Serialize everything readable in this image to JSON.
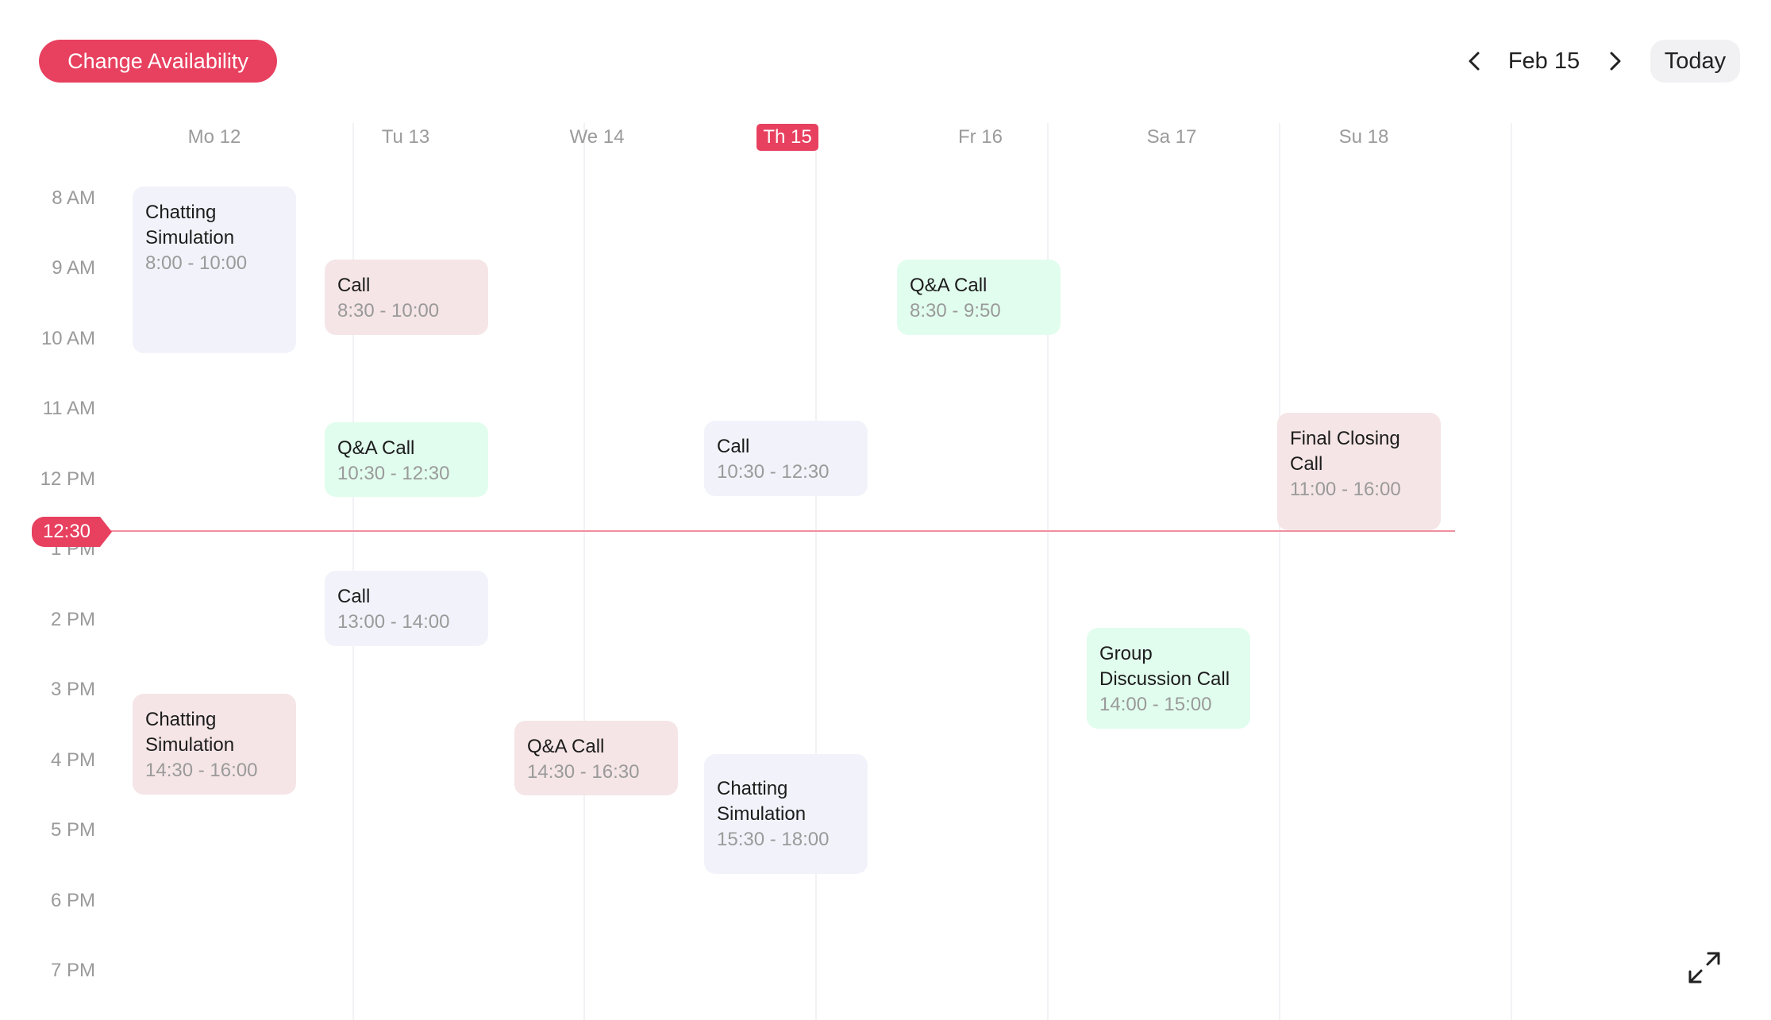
{
  "header": {
    "change_availability_label": "Change Availability",
    "current_date": "Feb 15",
    "today_label": "Today",
    "prev_icon": "chevron-left-icon",
    "next_icon": "chevron-right-icon"
  },
  "days": [
    {
      "label": "Mo 12",
      "is_today": false
    },
    {
      "label": "Tu 13",
      "is_today": false
    },
    {
      "label": "We 14",
      "is_today": false
    },
    {
      "label": "Th 15",
      "is_today": true
    },
    {
      "label": "Fr 16",
      "is_today": false
    },
    {
      "label": "Sa 17",
      "is_today": false
    },
    {
      "label": "Su 18",
      "is_today": false
    }
  ],
  "hours": [
    "8 AM",
    "9 AM",
    "10 AM",
    "11 AM",
    "12 PM",
    "1 PM",
    "2 PM",
    "3 PM",
    "4 PM",
    "5 PM",
    "6 PM",
    "7 PM"
  ],
  "current_time": "12:30",
  "colors": {
    "accent": "#e8405f",
    "lavender": "#f2f3fa",
    "rose": "#f5e5e6",
    "mint": "#e1fdee"
  },
  "events": [
    {
      "day": "Mo 12",
      "title": "Chatting Simulation",
      "time": "8:00 - 10:00",
      "color": "lavender"
    },
    {
      "day": "Tu 13",
      "title": "Call",
      "time": "8:30 - 10:00",
      "color": "rose"
    },
    {
      "day": "Fr 16",
      "title": "Q&A Call",
      "time": "8:30 - 9:50",
      "color": "mint"
    },
    {
      "day": "Tu 13",
      "title": "Q&A Call",
      "time": "10:30 - 12:30",
      "color": "mint"
    },
    {
      "day": "Th 15",
      "title": "Call",
      "time": "10:30 - 12:30",
      "color": "lavender"
    },
    {
      "day": "Su 18",
      "title": "Final Closing Call",
      "time": "11:00 - 16:00",
      "color": "rose"
    },
    {
      "day": "Tu 13",
      "title": "Call",
      "time": "13:00 - 14:00",
      "color": "lavender"
    },
    {
      "day": "Sa 17",
      "title": "Group Discussion Call",
      "time": "14:00 - 15:00",
      "color": "mint"
    },
    {
      "day": "Mo 12",
      "title": "Chatting Simulation",
      "time": "14:30 - 16:00",
      "color": "rose"
    },
    {
      "day": "We 14",
      "title": "Q&A Call",
      "time": "14:30 - 16:30",
      "color": "rose"
    },
    {
      "day": "Th 15",
      "title": "Chatting Simulation",
      "time": "15:30 - 18:00",
      "color": "lavender"
    }
  ],
  "footer": {
    "expand_icon": "expand-icon"
  }
}
